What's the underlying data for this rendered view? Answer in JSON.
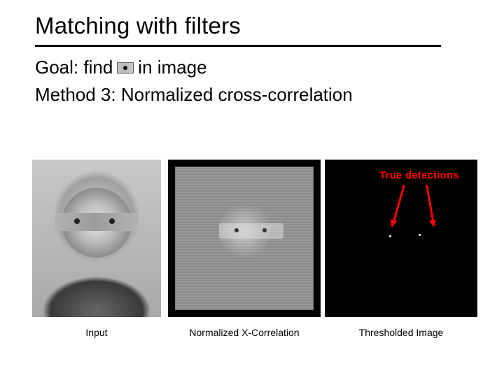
{
  "title": "Matching with filters",
  "line1_pre": "Goal: find",
  "line1_post": "in image",
  "line2": "Method 3: Normalized cross-correlation",
  "annotation": "True detections",
  "captions": {
    "input": "Input",
    "xcorr": "Normalized X-Correlation",
    "thresh": "Thresholded Image"
  }
}
